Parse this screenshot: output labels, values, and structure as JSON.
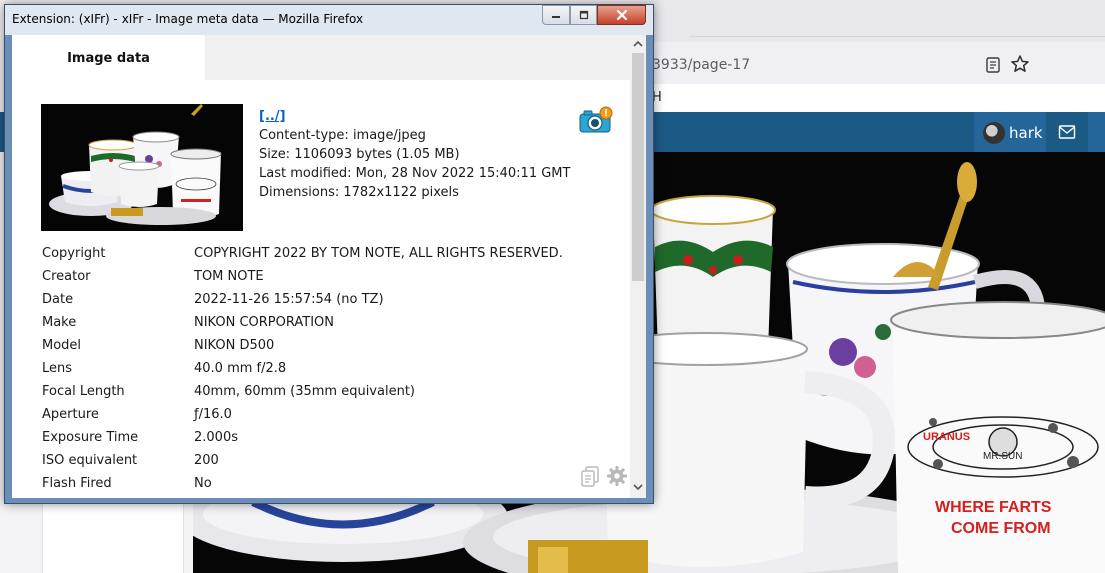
{
  "background_page": {
    "url_fragment": "3933/page-17",
    "breadcrumb_fragment": "H",
    "username": "hark"
  },
  "popup": {
    "title": "Extension: (xIFr) - xIFr - Image meta data — Mozilla Firefox",
    "tab_label": "Image data",
    "file": {
      "link": "[../]",
      "content_type": "Content-type: image/jpeg",
      "size": "Size: 1106093 bytes (1.05 MB)",
      "last_modified": "Last modified: Mon, 28 Nov 2022 15:40:11 GMT",
      "dimensions": "Dimensions: 1782x1122 pixels"
    },
    "metadata": [
      {
        "label": "Copyright",
        "value": "COPYRIGHT 2022 BY TOM NOTE, ALL RIGHTS RESERVED."
      },
      {
        "label": "Creator",
        "value": "TOM NOTE"
      },
      {
        "label": "Date",
        "value": "2022-11-26 15:57:54 (no TZ)"
      },
      {
        "label": "Make",
        "value": "NIKON CORPORATION"
      },
      {
        "label": "Model",
        "value": "NIKON D500"
      },
      {
        "label": "Lens",
        "value": "40.0 mm f/2.8"
      },
      {
        "label": "Focal Length",
        "value": "40mm, 60mm (35mm equivalent)"
      },
      {
        "label": "Aperture",
        "value": "ƒ/16.0"
      },
      {
        "label": "Exposure Time",
        "value": "2.000s"
      },
      {
        "label": "ISO equivalent",
        "value": "200"
      },
      {
        "label": "Flash Fired",
        "value": "No"
      }
    ]
  },
  "mug_text": {
    "line1": "WHERE FARTS",
    "line2": "COME FROM",
    "uranus": "URANUS",
    "mrsun": "MR.SUN"
  },
  "colors": {
    "navbar": "#1c5a86",
    "link": "#0b5fc9",
    "mug_red": "#d42020"
  }
}
